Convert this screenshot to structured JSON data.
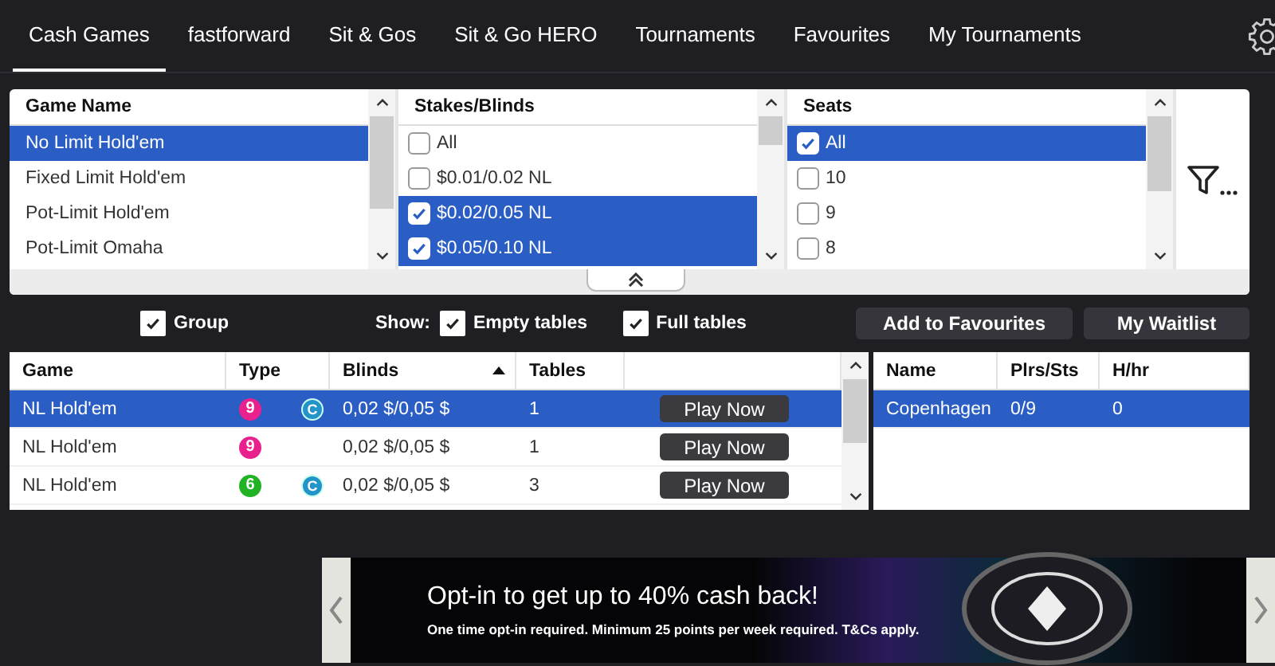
{
  "tabs": [
    {
      "label": "Cash Games",
      "selected": true
    },
    {
      "label": "fastforward",
      "selected": false
    },
    {
      "label": "Sit & Gos",
      "selected": false
    },
    {
      "label": "Sit & Go HERO",
      "selected": false
    },
    {
      "label": "Tournaments",
      "selected": false
    },
    {
      "label": "Favourites",
      "selected": false
    },
    {
      "label": "My Tournaments",
      "selected": false
    }
  ],
  "filters": [
    {
      "heading": "Game Name",
      "kind": "plain",
      "items": [
        {
          "label": "No Limit Hold'em",
          "selected": true
        },
        {
          "label": "Fixed Limit Hold'em",
          "selected": false
        },
        {
          "label": "Pot-Limit Hold'em",
          "selected": false
        },
        {
          "label": "Pot-Limit Omaha",
          "selected": false
        }
      ]
    },
    {
      "heading": "Stakes/Blinds",
      "kind": "check",
      "items": [
        {
          "label": "All",
          "checked": false
        },
        {
          "label": "$0.01/0.02 NL",
          "checked": false
        },
        {
          "label": "$0.02/0.05 NL",
          "checked": true
        },
        {
          "label": "$0.05/0.10 NL",
          "checked": true
        }
      ]
    },
    {
      "heading": "Seats",
      "kind": "check",
      "items": [
        {
          "label": "All",
          "checked": true
        },
        {
          "label": "10",
          "checked": false
        },
        {
          "label": "9",
          "checked": false
        },
        {
          "label": "8",
          "checked": false
        }
      ]
    }
  ],
  "options": {
    "group": {
      "label": "Group",
      "checked": true
    },
    "show_label": "Show:",
    "empty_tables": {
      "label": "Empty tables",
      "checked": true
    },
    "full_tables": {
      "label": "Full tables",
      "checked": true
    }
  },
  "buttons": [
    "Add to Favourites",
    "My Waitlist"
  ],
  "games_table": {
    "columns": [
      "Game",
      "Type",
      "Blinds",
      "Tables"
    ],
    "rows": [
      {
        "game": "NL Hold'em",
        "seats": "9",
        "color": "#e8218f",
        "badge": "C",
        "blinds": "0,02 $/0,05 $",
        "tables": "1",
        "action": "Play Now",
        "selected": true
      },
      {
        "game": "NL Hold'em",
        "seats": "9",
        "color": "#e8218f",
        "blinds": "0,02 $/0,05 $",
        "tables": "1",
        "action": "Play Now",
        "selected": false
      },
      {
        "game": "NL Hold'em",
        "seats": "6",
        "color": "#21b323",
        "badge": "C",
        "blinds": "0,02 $/0,05 $",
        "tables": "3",
        "action": "Play Now",
        "selected": false
      }
    ]
  },
  "tables_table": {
    "columns": [
      "Name",
      "Plrs/Sts",
      "H/hr"
    ],
    "rows": [
      {
        "cells": [
          "Copenhagen",
          "0/9",
          "0"
        ],
        "selected": true
      }
    ]
  },
  "banner": {
    "headline": "Opt-in to get up to 40% cash back!",
    "fine_print": "One time opt-in required. Minimum 25 points per week required. T&Cs apply."
  }
}
